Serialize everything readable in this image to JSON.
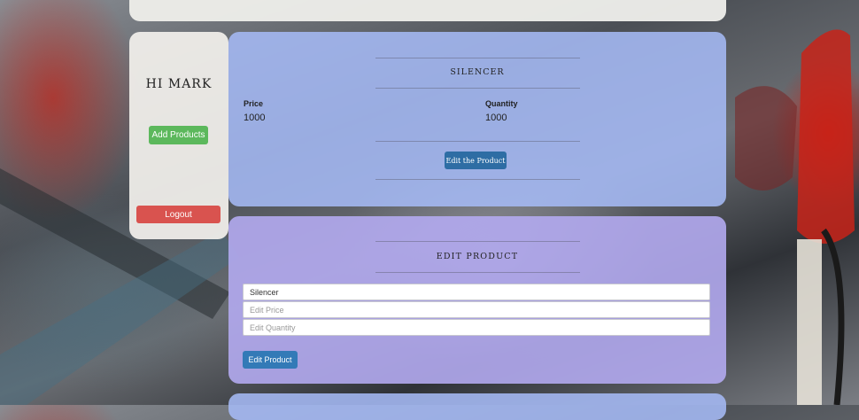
{
  "sidebar": {
    "greeting": "HI MARK",
    "add_label": "Add Products",
    "logout_label": "Logout"
  },
  "product": {
    "title": "SILENCER",
    "price_label": "Price",
    "price_value": "1000",
    "quantity_label": "Quantity",
    "quantity_value": "1000",
    "edit_label": "Edit the Product"
  },
  "edit_form": {
    "title": "EDIT PRODUCT",
    "name_value": "Silencer",
    "price_placeholder": "Edit Price",
    "quantity_placeholder": "Edit Quantity",
    "submit_label": "Edit Product"
  },
  "colors": {
    "add_button": "#5cb85c",
    "logout_button": "#d9534f",
    "primary_button": "#337ab7"
  }
}
